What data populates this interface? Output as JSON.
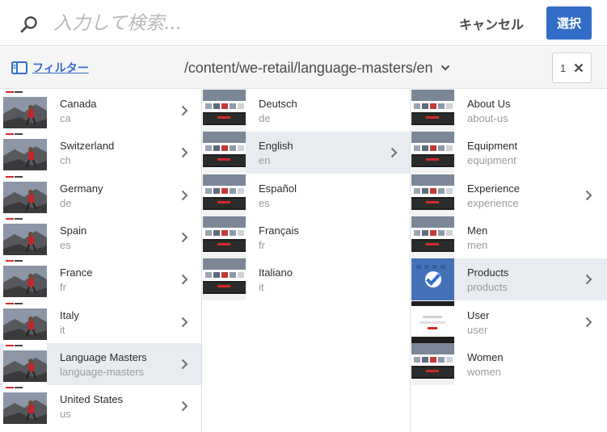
{
  "search": {
    "placeholder": "入力して検索..."
  },
  "header": {
    "cancel_label": "キャンセル",
    "select_label": "選択"
  },
  "toolbar": {
    "filter_label": "フィルター",
    "path": "/content/we-retail/language-masters/en",
    "selection_count": "1"
  },
  "columns": [
    {
      "items": [
        {
          "title": "Canada",
          "name": "ca",
          "has_children": true,
          "selected": false
        },
        {
          "title": "Switzerland",
          "name": "ch",
          "has_children": true,
          "selected": false
        },
        {
          "title": "Germany",
          "name": "de",
          "has_children": true,
          "selected": false
        },
        {
          "title": "Spain",
          "name": "es",
          "has_children": true,
          "selected": false
        },
        {
          "title": "France",
          "name": "fr",
          "has_children": true,
          "selected": false
        },
        {
          "title": "Italy",
          "name": "it",
          "has_children": true,
          "selected": false
        },
        {
          "title": "Language Masters",
          "name": "language-masters",
          "has_children": true,
          "selected": true
        },
        {
          "title": "United States",
          "name": "us",
          "has_children": true,
          "selected": false
        }
      ]
    },
    {
      "items": [
        {
          "title": "Deutsch",
          "name": "de",
          "has_children": false,
          "selected": false
        },
        {
          "title": "English",
          "name": "en",
          "has_children": true,
          "selected": true
        },
        {
          "title": "Español",
          "name": "es",
          "has_children": false,
          "selected": false
        },
        {
          "title": "Français",
          "name": "fr",
          "has_children": false,
          "selected": false
        },
        {
          "title": "Italiano",
          "name": "it",
          "has_children": false,
          "selected": false
        }
      ]
    },
    {
      "items": [
        {
          "title": "About Us",
          "name": "about-us",
          "has_children": false,
          "checked": false
        },
        {
          "title": "Equipment",
          "name": "equipment",
          "has_children": false,
          "checked": false
        },
        {
          "title": "Experience",
          "name": "experience",
          "has_children": true,
          "checked": false
        },
        {
          "title": "Men",
          "name": "men",
          "has_children": false,
          "checked": false
        },
        {
          "title": "Products",
          "name": "products",
          "has_children": true,
          "checked": true
        },
        {
          "title": "User",
          "name": "user",
          "has_children": true,
          "checked": false
        },
        {
          "title": "Women",
          "name": "women",
          "has_children": false,
          "checked": false
        }
      ]
    }
  ],
  "colors": {
    "accent": "#326ec8",
    "selected_row": "#e8ebef",
    "toolbar_bg": "#f5f5f5"
  },
  "icons": {
    "search": "search-icon",
    "filter": "rail-panel-icon",
    "path_dropdown": "chevron-down-icon",
    "clear_selection": "close-icon",
    "drill_in": "chevron-right-icon",
    "checked": "checkmark-icon"
  }
}
